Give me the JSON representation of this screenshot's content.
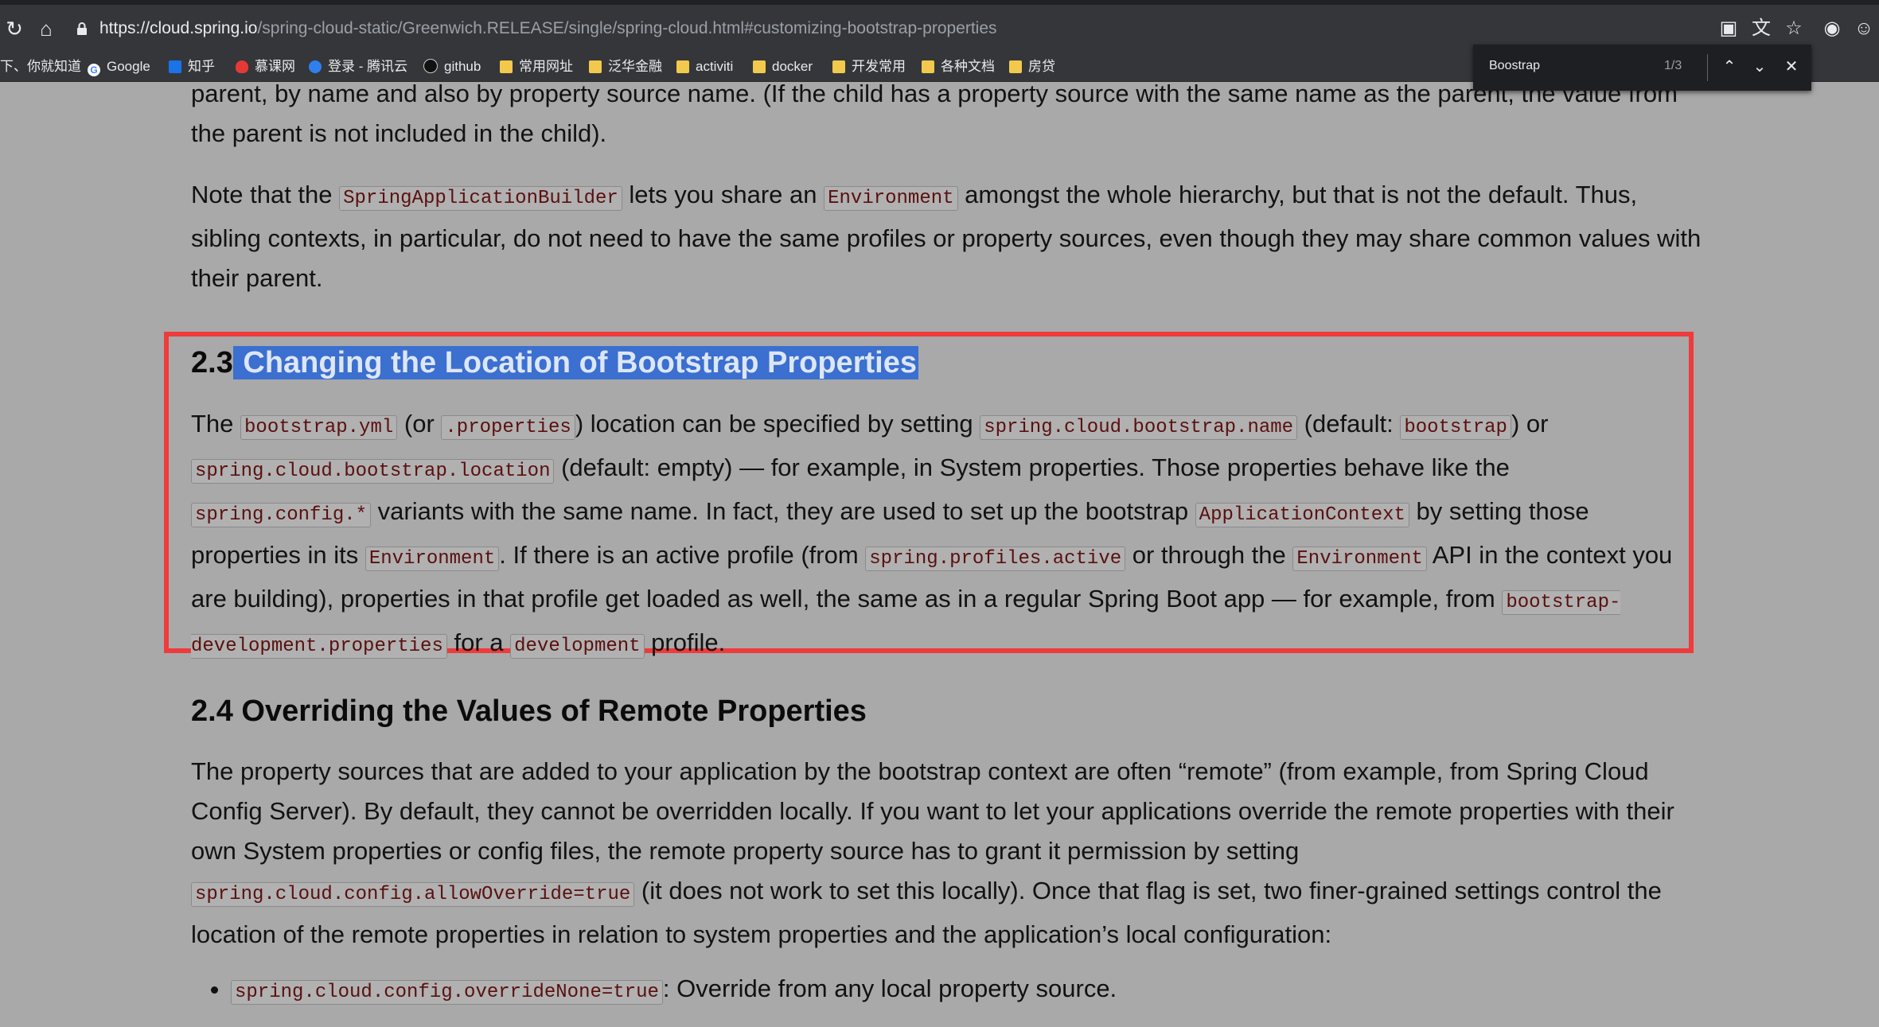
{
  "browser": {
    "url_host": "https://cloud.spring.io",
    "url_path": "/spring-cloud-static/Greenwich.RELEASE/single/spring-cloud.html#customizing-bootstrap-properties",
    "bookmarks": [
      {
        "label": "下、你就知道",
        "icon": "none"
      },
      {
        "label": "Google",
        "icon": "google-icon"
      },
      {
        "label": "知乎",
        "icon": "zhihu-icon"
      },
      {
        "label": "慕课网",
        "icon": "flame-icon"
      },
      {
        "label": "登录 - 腾讯云",
        "icon": "cloud-icon"
      },
      {
        "label": "github",
        "icon": "github-icon"
      },
      {
        "label": "常用网址",
        "icon": "folder-icon"
      },
      {
        "label": "泛华金融",
        "icon": "folder-icon"
      },
      {
        "label": "activiti",
        "icon": "folder-icon"
      },
      {
        "label": "docker",
        "icon": "folder-icon"
      },
      {
        "label": "开发常用",
        "icon": "folder-icon"
      },
      {
        "label": "各种文档",
        "icon": "folder-icon"
      },
      {
        "label": "房贷",
        "icon": "folder-icon"
      }
    ]
  },
  "find": {
    "query": "Boostrap",
    "count": "1/3"
  },
  "content": {
    "p_top": "parent, by name and also by property source name. (If the child has a property source with the same name as the parent, the value from the parent is not included in the child).",
    "p_note": {
      "t1": "Note that the ",
      "c1": "SpringApplicationBuilder",
      "t2": " lets you share an ",
      "c2": "Environment",
      "t3": " amongst the whole hierarchy, but that is not the default. Thus, sibling contexts, in particular, do not need to have the same profiles or property sources, even though they may share common values with their parent."
    },
    "h23_number": "2.3",
    "h23_title": " Changing the Location of Bootstrap Properties",
    "p23": {
      "t1": "The ",
      "c1": "bootstrap.yml",
      "t2": " (or ",
      "c2": ".properties",
      "t3": ") location can be specified by setting ",
      "c3": "spring.cloud.bootstrap.name",
      "t4": " (default: ",
      "c4": "bootstrap",
      "t5": ") or ",
      "c5": "spring.cloud.bootstrap.location",
      "t6": " (default: empty) — for example, in System properties. Those properties behave like the ",
      "c6": "spring.config.*",
      "t7": " variants with the same name. In fact, they are used to set up the bootstrap ",
      "c7": "ApplicationContext",
      "t8": " by setting those properties in its ",
      "c8": "Environment",
      "t9": ". If there is an active profile (from ",
      "c9": "spring.profiles.active",
      "t10": " or through the ",
      "c10": "Environment",
      "t11": " API in the context you are building), properties in that profile get loaded as well, the same as in a regular Spring Boot app — for example, from ",
      "c11": "bootstrap-development.properties",
      "t12": " for a ",
      "c12": "development",
      "t13": " profile."
    },
    "h24": "2.4 Overriding the Values of Remote Properties",
    "p24": {
      "t1": "The property sources that are added to your application by the bootstrap context are often “remote” (from example, from Spring Cloud Config Server). By default, they cannot be overridden locally. If you want to let your applications override the remote properties with their own System properties or config files, the remote property source has to grant it permission by setting ",
      "c1": "spring.cloud.config.allowOverride=true",
      "t2": " (it does not work to set this locally). Once that flag is set, two finer-grained settings control the location of the remote properties in relation to system properties and the application’s local configuration:"
    },
    "bullet1": {
      "c1": "spring.cloud.config.overrideNone=true",
      "t1": ": Override from any local property source."
    }
  }
}
